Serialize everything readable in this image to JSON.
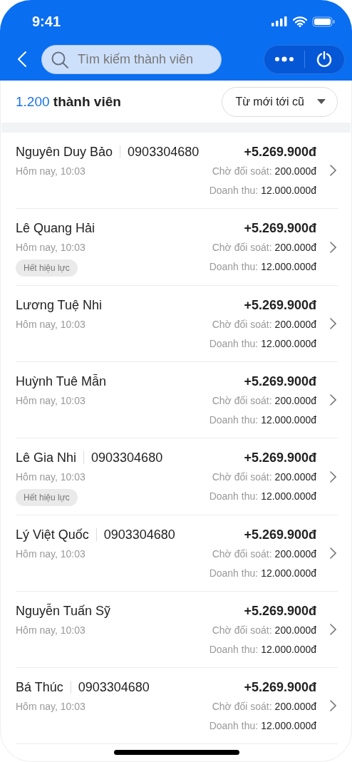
{
  "status_bar": {
    "time": "9:41"
  },
  "search": {
    "placeholder": "Tìm kiếm thành viên"
  },
  "summary": {
    "count": "1.200",
    "label": "thành viên"
  },
  "sort": {
    "label": "Từ mới tới cũ"
  },
  "members": [
    {
      "name": "Nguyên Duy Bảo",
      "phone": "0903304680",
      "time": "Hôm nay, 10:03",
      "expired": false,
      "amount": "+5.269.900đ",
      "pending_label": "Chờ đối soát:",
      "pending": "200.000đ",
      "revenue_label": "Doanh thu:",
      "revenue": "12.000.000đ"
    },
    {
      "name": "Lê Quang Hải",
      "time": "Hôm nay, 10:03",
      "expired": true,
      "badge": "Hết hiệu lực",
      "amount": "+5.269.900đ",
      "pending_label": "Chờ đối soát:",
      "pending": "200.000đ",
      "revenue_label": "Doanh thu:",
      "revenue": "12.000.000đ"
    },
    {
      "name": "Lương Tuệ Nhi",
      "time": "Hôm nay, 10:03",
      "expired": false,
      "amount": "+5.269.900đ",
      "pending_label": "Chờ đối soát:",
      "pending": "200.000đ",
      "revenue_label": "Doanh thu:",
      "revenue": "12.000.000đ"
    },
    {
      "name": "Huỳnh Tuê Mẫn",
      "time": "Hôm nay, 10:03",
      "expired": false,
      "amount": "+5.269.900đ",
      "pending_label": "Chờ đối soát:",
      "pending": "200.000đ",
      "revenue_label": "Doanh thu:",
      "revenue": "12.000.000đ"
    },
    {
      "name": "Lê Gia Nhi",
      "phone": "0903304680",
      "time": "Hôm nay, 10:03",
      "expired": true,
      "badge": "Hết hiệu lực",
      "amount": "+5.269.900đ",
      "pending_label": "Chờ đối soát:",
      "pending": "200.000đ",
      "revenue_label": "Doanh thu:",
      "revenue": "12.000.000đ"
    },
    {
      "name": "Lý Việt Quốc",
      "phone": "0903304680",
      "time": "Hôm nay, 10:03",
      "expired": false,
      "amount": "+5.269.900đ",
      "pending_label": "Chờ đối soát:",
      "pending": "200.000đ",
      "revenue_label": "Doanh thu:",
      "revenue": "12.000.000đ"
    },
    {
      "name": "Nguyễn Tuấn Sỹ",
      "time": "Hôm nay, 10:03",
      "expired": false,
      "amount": "+5.269.900đ",
      "pending_label": "Chờ đối soát:",
      "pending": "200.000đ",
      "revenue_label": "Doanh thu:",
      "revenue": "12.000.000đ"
    },
    {
      "name": "Bá Thúc",
      "phone": "0903304680",
      "time": "Hôm nay, 10:03",
      "expired": false,
      "amount": "+5.269.900đ",
      "pending_label": "Chờ đối soát:",
      "pending": "200.000đ",
      "revenue_label": "Doanh thu:",
      "revenue": "12.000.000đ"
    }
  ]
}
